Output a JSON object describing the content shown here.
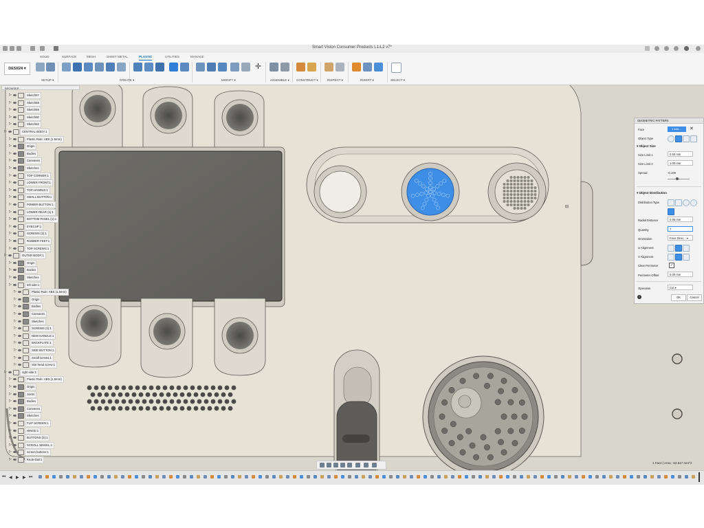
{
  "window": {
    "title": "Smart Vision Consumer Products L1-L2 v7*"
  },
  "ribbon": {
    "design_label": "DESIGN",
    "tabs": [
      "SOLID",
      "SURFACE",
      "MESH",
      "SHEET METAL",
      "PLASTIC",
      "UTILITIES",
      "MANAGE"
    ],
    "active_tab": "PLASTIC",
    "groups": [
      "SETUP",
      "CREATE",
      "MODIFY",
      "ASSEMBLE",
      "CONSTRUCT",
      "INSPECT",
      "INSERT",
      "SELECT"
    ]
  },
  "browser": {
    "title": "BROWSER",
    "rows": [
      {
        "label": "Sketch57",
        "level": 2,
        "type": "sketch"
      },
      {
        "label": "Sketch58",
        "level": 2,
        "type": "sketch"
      },
      {
        "label": "Sketch59",
        "level": 2,
        "type": "sketch"
      },
      {
        "label": "Sketch60",
        "level": 2,
        "type": "sketch"
      },
      {
        "label": "Sketch62",
        "level": 2,
        "type": "sketch"
      },
      {
        "label": "CENTRAL BODY:1",
        "level": 1,
        "type": "component"
      },
      {
        "label": "Plastic Rule: ABS (1.5mm)",
        "level": 2,
        "type": "rule"
      },
      {
        "label": "Origin",
        "level": 2,
        "type": "folder"
      },
      {
        "label": "Bodies",
        "level": 2,
        "type": "folder"
      },
      {
        "label": "Canvases",
        "level": 2,
        "type": "folder"
      },
      {
        "label": "Sketches",
        "level": 2,
        "type": "folder"
      },
      {
        "label": "TOP CORNER:1",
        "level": 2,
        "type": "component"
      },
      {
        "label": "LOWER FRONT:1",
        "level": 2,
        "type": "component"
      },
      {
        "label": "TOP HANDLE:1",
        "level": 2,
        "type": "component"
      },
      {
        "label": "SMALL BUTTON:1",
        "level": 2,
        "type": "component"
      },
      {
        "label": "POWER BUTTON:1",
        "level": 2,
        "type": "component"
      },
      {
        "label": "LOWER REAR (1):1",
        "level": 2,
        "type": "component"
      },
      {
        "label": "BOTTOM PANEL (1):1",
        "level": 2,
        "type": "component"
      },
      {
        "label": "EYECUP:1",
        "level": 2,
        "type": "component"
      },
      {
        "label": "SCREWS (2):1",
        "level": 2,
        "type": "component"
      },
      {
        "label": "RUBBER FEET:1",
        "level": 2,
        "type": "component"
      },
      {
        "label": "TOP SCREWS:1",
        "level": 2,
        "type": "component"
      },
      {
        "label": "OUTER BODY:1",
        "level": 1,
        "type": "component"
      },
      {
        "label": "Origin",
        "level": 2,
        "type": "folder"
      },
      {
        "label": "Bodies",
        "level": 2,
        "type": "folder"
      },
      {
        "label": "Sketches",
        "level": 2,
        "type": "folder"
      },
      {
        "label": "left side:1",
        "level": 2,
        "type": "component"
      },
      {
        "label": "Plastic Rule: ABS (1.5mm)",
        "level": 3,
        "type": "rule"
      },
      {
        "label": "Origin",
        "level": 3,
        "type": "folder"
      },
      {
        "label": "Bodies",
        "level": 3,
        "type": "folder"
      },
      {
        "label": "Canvases",
        "level": 3,
        "type": "folder"
      },
      {
        "label": "Sketches",
        "level": 3,
        "type": "folder"
      },
      {
        "label": "SCREWS (1):1",
        "level": 3,
        "type": "component"
      },
      {
        "label": "NEW HANDLE:1",
        "level": 3,
        "type": "component"
      },
      {
        "label": "BACKPLATE:1",
        "level": 3,
        "type": "component"
      },
      {
        "label": "SIDE BUTTON:1",
        "level": 3,
        "type": "component"
      },
      {
        "label": "Small screws:1",
        "level": 3,
        "type": "component"
      },
      {
        "label": "Slot head screw:1",
        "level": 3,
        "type": "component"
      },
      {
        "label": "right side:1",
        "level": 1,
        "type": "component"
      },
      {
        "label": "Plastic Rule: ABS (1.5mm)",
        "level": 2,
        "type": "rule"
      },
      {
        "label": "Origin",
        "level": 2,
        "type": "folder"
      },
      {
        "label": "Joints",
        "level": 2,
        "type": "folder"
      },
      {
        "label": "Bodies",
        "level": 2,
        "type": "folder"
      },
      {
        "label": "Canvases",
        "level": 2,
        "type": "folder"
      },
      {
        "label": "Sketches",
        "level": 2,
        "type": "folder"
      },
      {
        "label": "FLIP SCREEN:1",
        "level": 2,
        "type": "component"
      },
      {
        "label": "HINGE:1",
        "level": 2,
        "type": "component"
      },
      {
        "label": "BUTTONS (2):1",
        "level": 2,
        "type": "component"
      },
      {
        "label": "SCROLL WHEEL:1",
        "level": 2,
        "type": "component"
      },
      {
        "label": "screen buttons:1",
        "level": 2,
        "type": "component"
      },
      {
        "label": "Knob-Dial:1",
        "level": 2,
        "type": "component"
      }
    ]
  },
  "panel": {
    "title": "GEOMETRIC PATTERN",
    "face_label": "Face",
    "face_value": "1 sele...",
    "object_type_label": "Object Type",
    "object_size_header": "Object Size",
    "size_limit_1_label": "Size Limit 1",
    "size_limit_1_value": "0.50 mm",
    "size_limit_2_label": "Size Limit 2",
    "size_limit_2_value": "1.00 mm",
    "spread_label": "Spread",
    "spread_value": "-0.109",
    "spread_level": 0.45,
    "object_distribution_header": "Object Distribution",
    "distribution_type_label": "Distribution Type",
    "radial_distance_label": "Radial Distance",
    "radial_distance_value": "0.95 mm",
    "quantity_label": "Quantity",
    "quantity_value": "7",
    "orientation_label": "Orientation",
    "orientation_value": "Face Direc...",
    "u_alignment_label": "U Alignment",
    "v_alignment_label": "V Alignment",
    "clear_perimeter_label": "Clear Perimeter",
    "perimeter_offset_label": "Perimeter Offset",
    "perimeter_offset_value": "0.00 mm",
    "operation_label": "Operation",
    "operation_value": "Cut",
    "ok_label": "OK",
    "cancel_label": "Cancel"
  },
  "status": {
    "text": "1 Face | Area : 63.617 mm^2"
  },
  "colors": {
    "accent": "#0b73c8",
    "selection": "#3f8ee6",
    "model": "#e6e2d6",
    "background": "#d9d6cb"
  }
}
